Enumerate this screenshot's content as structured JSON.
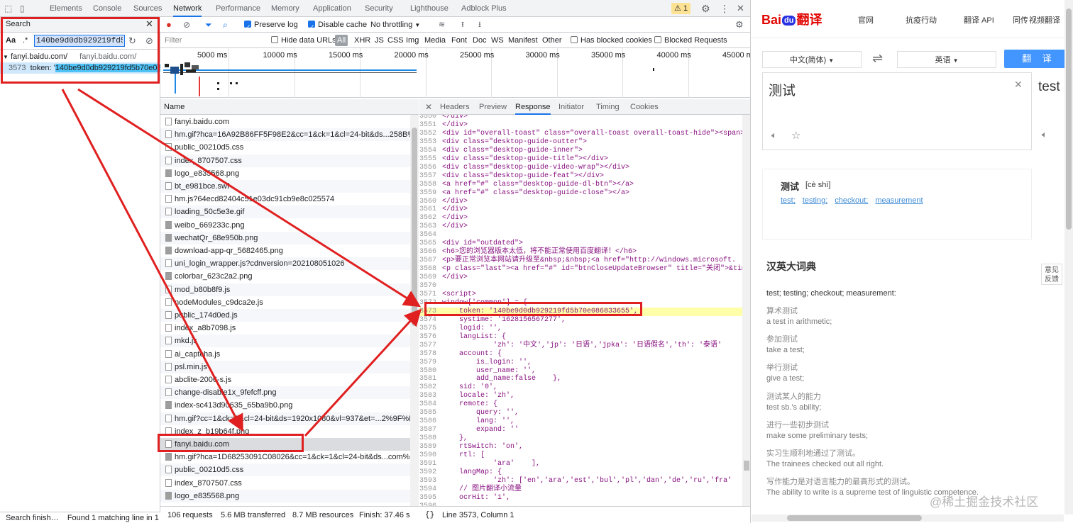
{
  "devtools": {
    "tabs": [
      "Elements",
      "Console",
      "Sources",
      "Network",
      "Performance",
      "Memory",
      "Application",
      "Security",
      "Lighthouse",
      "Adblock Plus"
    ],
    "active_tab": "Network",
    "warning_count": "1",
    "toolbar": {
      "preserve_log": "Preserve log",
      "disable_cache": "Disable cache",
      "throttling": "No throttling"
    },
    "filterbar": {
      "filter_placeholder": "Filter",
      "hide_data_urls": "Hide data URLs",
      "types": [
        "All",
        "XHR",
        "JS",
        "CSS",
        "Img",
        "Media",
        "Font",
        "Doc",
        "WS",
        "Manifest",
        "Other"
      ],
      "has_blocked_cookies": "Has blocked cookies",
      "blocked_requests": "Blocked Requests"
    },
    "search": {
      "title": "Search",
      "case_label": "Aa",
      "regex_label": ".*",
      "query": "140be9d0db929219fd5b70e086833655",
      "result_file": "fanyi.baidu.com/",
      "result_file_path": "fanyi.baidu.com/",
      "result_line_no": "3573",
      "result_line_prefix": "token: '",
      "result_line_match": "140be9d0db929219fd5b70e08",
      "status": "Search finish…",
      "status_detail": "Found 1 matching line in 1 f…"
    },
    "overview_ticks": [
      "5000 ms",
      "10000 ms",
      "15000 ms",
      "20000 ms",
      "25000 ms",
      "30000 ms",
      "35000 ms",
      "40000 ms",
      "45000 ms"
    ],
    "request_list": {
      "header": "Name",
      "rows": [
        "fanyi.baidu.com",
        "hm.gif?hca=16A92B86FF5F98E2&cc=1&ck=1&cl=24-bit&ds...258B%25...",
        "public_00210d5.css",
        "index_8707507.css",
        "logo_e835568.png",
        "bt_e981bce.swf",
        "hm.js?64ecd82404c51e03dc91cb9e8c025574",
        "loading_50c5e3e.gif",
        "weibo_669233c.png",
        "wechatQr_68e950b.png",
        "download-app-qr_5682465.png",
        "uni_login_wrapper.js?cdnversion=202108051026",
        "colorbar_623c2a2.png",
        "mod_b80b8f9.js",
        "nodeModules_c9dca2e.js",
        "public_174d0ed.js",
        "index_a8b7098.js",
        "mkd.js",
        "ai_captcha.js",
        "psl.min.js",
        "abclite-2006-s.js",
        "change-disable1x_9fefcff.png",
        "index-sc413d90635_65ba9b0.png",
        "hm.gif?cc=1&ck=1&cl=24-bit&ds=1920x1080&vl=937&et=...2%9F%E9...",
        "index_z_b19b64f.png",
        "fanyi.baidu.com",
        "hm.gif?hca=1D68253091C08026&cc=1&ck=1&cl=24-bit&ds...com%2F...",
        "public_00210d5.css",
        "index_8707507.css",
        "logo_e835568.png"
      ],
      "image_rows": [
        4,
        8,
        9,
        10,
        12,
        22,
        26,
        29
      ]
    },
    "status_bar": {
      "requests": "106 requests",
      "transferred": "5.6 MB transferred",
      "resources": "8.7 MB resources",
      "finish": "Finish: 37.46 s"
    },
    "response": {
      "tabs": [
        "Headers",
        "Preview",
        "Response",
        "Initiator",
        "Timing",
        "Cookies"
      ],
      "active_tab": "Response",
      "status": "Line 3573, Column 1",
      "highlight_line": "3573",
      "lines": [
        [
          "3550",
          "</div>"
        ],
        [
          "3551",
          "</div>"
        ],
        [
          "3552",
          "<div id=\"overall-toast\" class=\"overall-toast overall-toast-hide\"><span></"
        ],
        [
          "3553",
          "<div class=\"desktop-guide-outter\">"
        ],
        [
          "3554",
          "<div class=\"desktop-guide-inner\">"
        ],
        [
          "3555",
          "<div class=\"desktop-guide-title\"></div>"
        ],
        [
          "3556",
          "<div class=\"desktop-guide-video-wrap\"></div>"
        ],
        [
          "3557",
          "<div class=\"desktop-guide-feat\"></div>"
        ],
        [
          "3558",
          "<a href=\"#\" class=\"desktop-guide-dl-btn\"></a>"
        ],
        [
          "3559",
          "<a href=\"#\" class=\"desktop-guide-close\"></a>"
        ],
        [
          "3560",
          "</div>"
        ],
        [
          "3561",
          "</div>"
        ],
        [
          "3562",
          "</div>"
        ],
        [
          "3563",
          "</div>"
        ],
        [
          "3564",
          ""
        ],
        [
          "3565",
          "<div id=\"outdated\">"
        ],
        [
          "3566",
          "<h6>您的浏览器版本太低，将不能正常使用百度翻译！</h6>"
        ],
        [
          "3567",
          "<p>要正常浏览本网站请升级至&nbsp;&nbsp;<a href=\"http://windows.microsoft."
        ],
        [
          "3568",
          "<p class=\"last\"><a href=\"#\" id=\"btnCloseUpdateBrowser\" title=\"关闭\">&tim"
        ],
        [
          "3569",
          "</div>"
        ],
        [
          "3570",
          ""
        ],
        [
          "3571",
          "<script>"
        ],
        [
          "3572",
          "window['common'] = {"
        ],
        [
          "3573",
          "    token: '140be9d0db929219fd5b70e086833655',"
        ],
        [
          "3574",
          "    systime: '1628156567277',"
        ],
        [
          "3575",
          "    logid: '',"
        ],
        [
          "3576",
          "    langList: {"
        ],
        [
          "3577",
          "            'zh': '中文','jp': '日语','jpka': '日语假名','th': '泰语'"
        ],
        [
          "3578",
          "    account: {"
        ],
        [
          "3579",
          "        is_login: '',"
        ],
        [
          "3580",
          "        user_name: '',"
        ],
        [
          "3581",
          "        add_name:false    },"
        ],
        [
          "3582",
          "    sid: '0',"
        ],
        [
          "3583",
          "    locale: 'zh',"
        ],
        [
          "3584",
          "    remote: {"
        ],
        [
          "3585",
          "        query: '',"
        ],
        [
          "3586",
          "        lang: '',"
        ],
        [
          "3587",
          "        expand: ''"
        ],
        [
          "3588",
          "    },"
        ],
        [
          "3589",
          "    rtSwitch: 'on',"
        ],
        [
          "3590",
          "    rtl: ["
        ],
        [
          "3591",
          "            'ara'    ],"
        ],
        [
          "3592",
          "    langMap: {"
        ],
        [
          "3593",
          "            'zh': ['en','ara','est','bul','pl','dan','de','ru','fra'"
        ],
        [
          "3594",
          "    // 图片翻译小流量"
        ],
        [
          "3595",
          "    ocrHit: '1',"
        ],
        [
          "3596",
          ""
        ]
      ]
    }
  },
  "baidu": {
    "logo_left": "Bai",
    "logo_paw": "du",
    "logo_right": "翻译",
    "nav": [
      "官网",
      "抗疫行动",
      "翻译 API",
      "同传",
      "视频翻译"
    ],
    "source_lang": "中文(简体)",
    "target_lang": "英语",
    "swap_icon": "⇌",
    "translate_button": "翻 译",
    "input_text": "测试",
    "output_text": "test",
    "word": "测试",
    "phonetic": "[cè shì]",
    "meanings": [
      "test;",
      "testing;",
      "checkout;",
      "measurement"
    ],
    "dict_title": "汉英大词典",
    "dict_summary": "test; testing; checkout; measurement:",
    "examples": [
      [
        "算术测试",
        "a test in arithmetic;"
      ],
      [
        "参加测试",
        "take a test;"
      ],
      [
        "举行测试",
        "give a test;"
      ],
      [
        "测试某人的能力",
        "test sb.'s ability;"
      ],
      [
        "进行一些初步测试",
        "make some preliminary tests;"
      ],
      [
        "实习生顺利地通过了测试。",
        "The trainees checked out all right."
      ],
      [
        "写作能力是对语言能力的最高形式的测试。",
        "The ability to write is a supreme test of linguistic competence."
      ]
    ],
    "feedback_line1": "意见",
    "feedback_line2": "反馈"
  },
  "watermark": "@稀土掘金技术社区",
  "colors": {
    "annotation_red": "#e02020",
    "devtools_accent": "#1a73e8",
    "baidu_blue": "#4395ff"
  }
}
